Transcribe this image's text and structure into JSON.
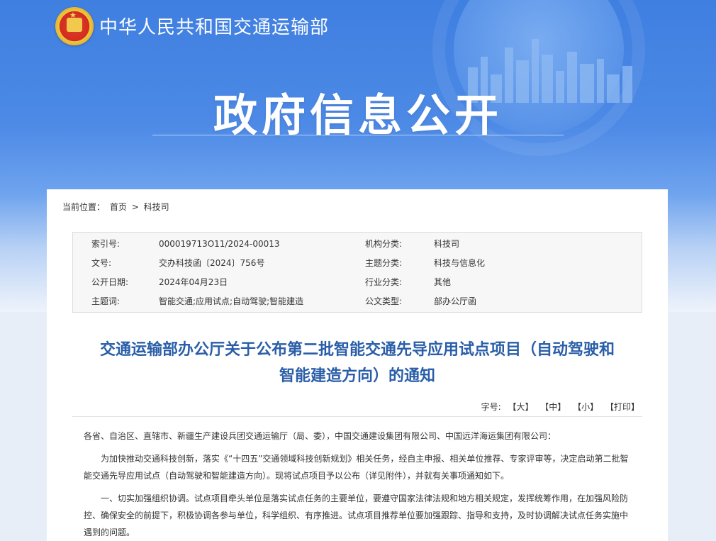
{
  "header": {
    "ministry_name": "中华人民共和国交通运输部",
    "section_title": "政府信息公开"
  },
  "breadcrumb": {
    "label": "当前位置：",
    "items": [
      "首页",
      "科技司"
    ],
    "separator": ">"
  },
  "info": {
    "rows": [
      {
        "k1": "索引号:",
        "v1": "000019713O11/2024-00013",
        "k2": "机构分类:",
        "v2": "科技司"
      },
      {
        "k1": "文号:",
        "v1": "交办科技函〔2024〕756号",
        "k2": "主题分类:",
        "v2": "科技与信息化"
      },
      {
        "k1": "公开日期:",
        "v1": "2024年04月23日",
        "k2": "行业分类:",
        "v2": "其他"
      },
      {
        "k1": "主题词:",
        "v1": "智能交通;应用试点;自动驾驶;智能建造",
        "k2": "公文类型:",
        "v2": "部办公厅函"
      }
    ]
  },
  "document": {
    "title_line1": "交通运输部办公厅关于公布第二批智能交通先导应用试点项目（自动驾驶和",
    "title_line2": "智能建造方向）的通知"
  },
  "font_size": {
    "label": "字号:",
    "large": "【大】",
    "medium": "【中】",
    "small": "【小】",
    "print": "【打印】"
  },
  "body": {
    "p1": "各省、自治区、直辖市、新疆生产建设兵团交通运输厅（局、委），中国交通建设集团有限公司、中国远洋海运集团有限公司：",
    "p2": "为加快推动交通科技创新，落实《“十四五”交通领域科技创新规划》相关任务，经自主申报、相关单位推荐、专家评审等，决定启动第二批智能交通先导应用试点（自动驾驶和智能建造方向）。现将试点项目予以公布（详见附件），并就有关事项通知如下。",
    "p3": "一、切实加强组织协调。试点项目牵头单位是落实试点任务的主要单位，要遵守国家法律法规和地方相关规定，发挥统筹作用，在加强风险防控、确保安全的前提下，积极协调各参与单位，科学组织、有序推进。试点项目推荐单位要加强跟踪、指导和支持，及时协调解决试点任务实施中遇到的问题。"
  },
  "colors": {
    "banner_top": "#3f7fe0",
    "title_blue": "#2a5ea8",
    "emblem_red": "#d12d1f",
    "emblem_gold": "#f0c640"
  }
}
